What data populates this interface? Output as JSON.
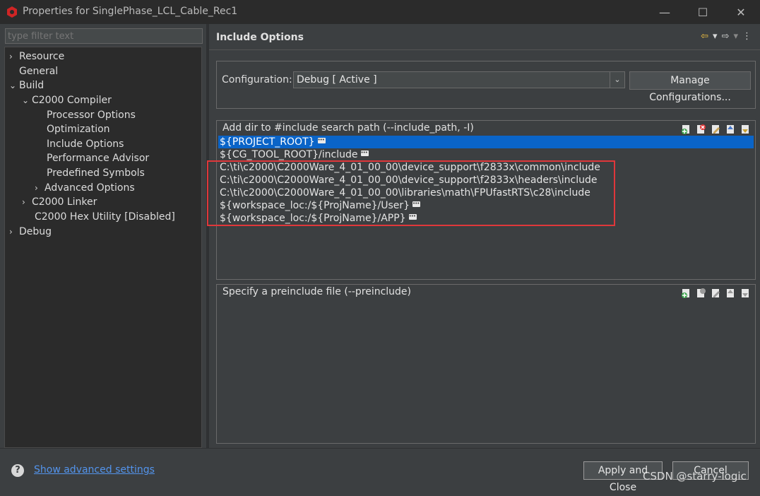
{
  "window": {
    "title": "Properties for SinglePhase_LCL_Cable_Rec1",
    "minimize": "—",
    "maximize": "☐",
    "close": "✕"
  },
  "filter": {
    "placeholder": "type filter text"
  },
  "tree": {
    "items": [
      {
        "label": "Resource",
        "chevron": "›"
      },
      {
        "label": "General",
        "chevron": ""
      },
      {
        "label": "Build",
        "chevron": "⌄"
      },
      {
        "label": "C2000 Compiler",
        "chevron": "⌄"
      },
      {
        "label": "Processor Options",
        "chevron": ""
      },
      {
        "label": "Optimization",
        "chevron": ""
      },
      {
        "label": "Include Options",
        "chevron": ""
      },
      {
        "label": "Performance Advisor",
        "chevron": ""
      },
      {
        "label": "Predefined Symbols",
        "chevron": ""
      },
      {
        "label": "Advanced Options",
        "chevron": "›"
      },
      {
        "label": "C2000 Linker",
        "chevron": "›"
      },
      {
        "label": "C2000 Hex Utility  [Disabled]",
        "chevron": ""
      },
      {
        "label": "Debug",
        "chevron": "›"
      }
    ]
  },
  "page": {
    "title": "Include Options",
    "nav": {
      "back": "⇦",
      "forward": "⇨",
      "menu": "⋮"
    }
  },
  "config": {
    "label": "Configuration:",
    "value": "Debug  [ Active ]",
    "manage_label": "Manage Configurations..."
  },
  "include_path": {
    "header": "Add dir to #include search path (--include_path, -I)",
    "items": [
      "${PROJECT_ROOT}",
      "${CG_TOOL_ROOT}/include",
      "C:\\ti\\c2000\\C2000Ware_4_01_00_00\\device_support\\f2833x\\common\\include",
      "C:\\ti\\c2000\\C2000Ware_4_01_00_00\\device_support\\f2833x\\headers\\include",
      "C:\\ti\\c2000\\C2000Ware_4_01_00_00\\libraries\\math\\FPUfastRTS\\c28\\include",
      "${workspace_loc:/${ProjName}/User}",
      "${workspace_loc:/${ProjName}/APP}"
    ],
    "selected_index": 0
  },
  "preinclude": {
    "header": "Specify a preinclude file (--preinclude)"
  },
  "footer": {
    "help": "?",
    "advanced_link": "Show advanced settings",
    "apply_close": "Apply and Close",
    "cancel": "Cancel"
  },
  "watermark": "CSDN @starry-logic",
  "colors": {
    "selection": "#0a64c8",
    "highlight_box": "#e0373a",
    "link": "#5394ec"
  }
}
